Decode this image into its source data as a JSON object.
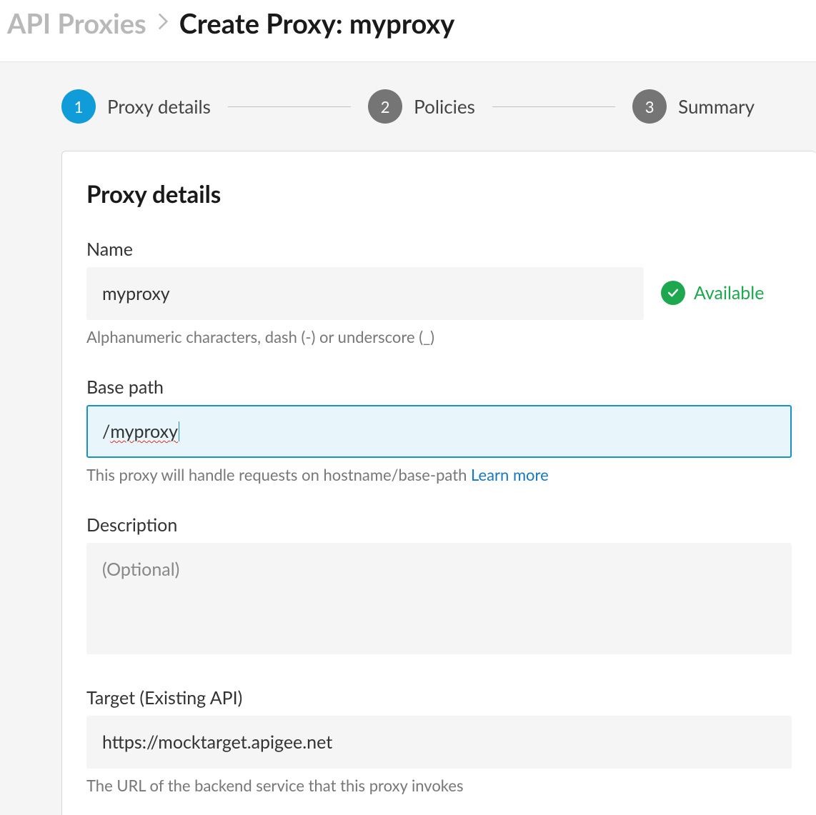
{
  "breadcrumb": {
    "parent": "API Proxies",
    "current": "Create Proxy: myproxy"
  },
  "stepper": {
    "steps": [
      {
        "num": "1",
        "label": "Proxy details",
        "active": true
      },
      {
        "num": "2",
        "label": "Policies",
        "active": false
      },
      {
        "num": "3",
        "label": "Summary",
        "active": false
      }
    ]
  },
  "card": {
    "title": "Proxy details"
  },
  "fields": {
    "name": {
      "label": "Name",
      "value": "myproxy",
      "hint": "Alphanumeric characters, dash (-) or underscore (_)",
      "availability": "Available"
    },
    "basepath": {
      "label": "Base path",
      "prefix": "/",
      "value_underlined": "myproxy",
      "hint": "This proxy will handle requests on hostname/base-path ",
      "learn_more": "Learn more"
    },
    "description": {
      "label": "Description",
      "placeholder": "(Optional)"
    },
    "target": {
      "label": "Target (Existing API)",
      "value": "https://mocktarget.apigee.net",
      "hint": "The URL of the backend service that this proxy invokes"
    }
  }
}
